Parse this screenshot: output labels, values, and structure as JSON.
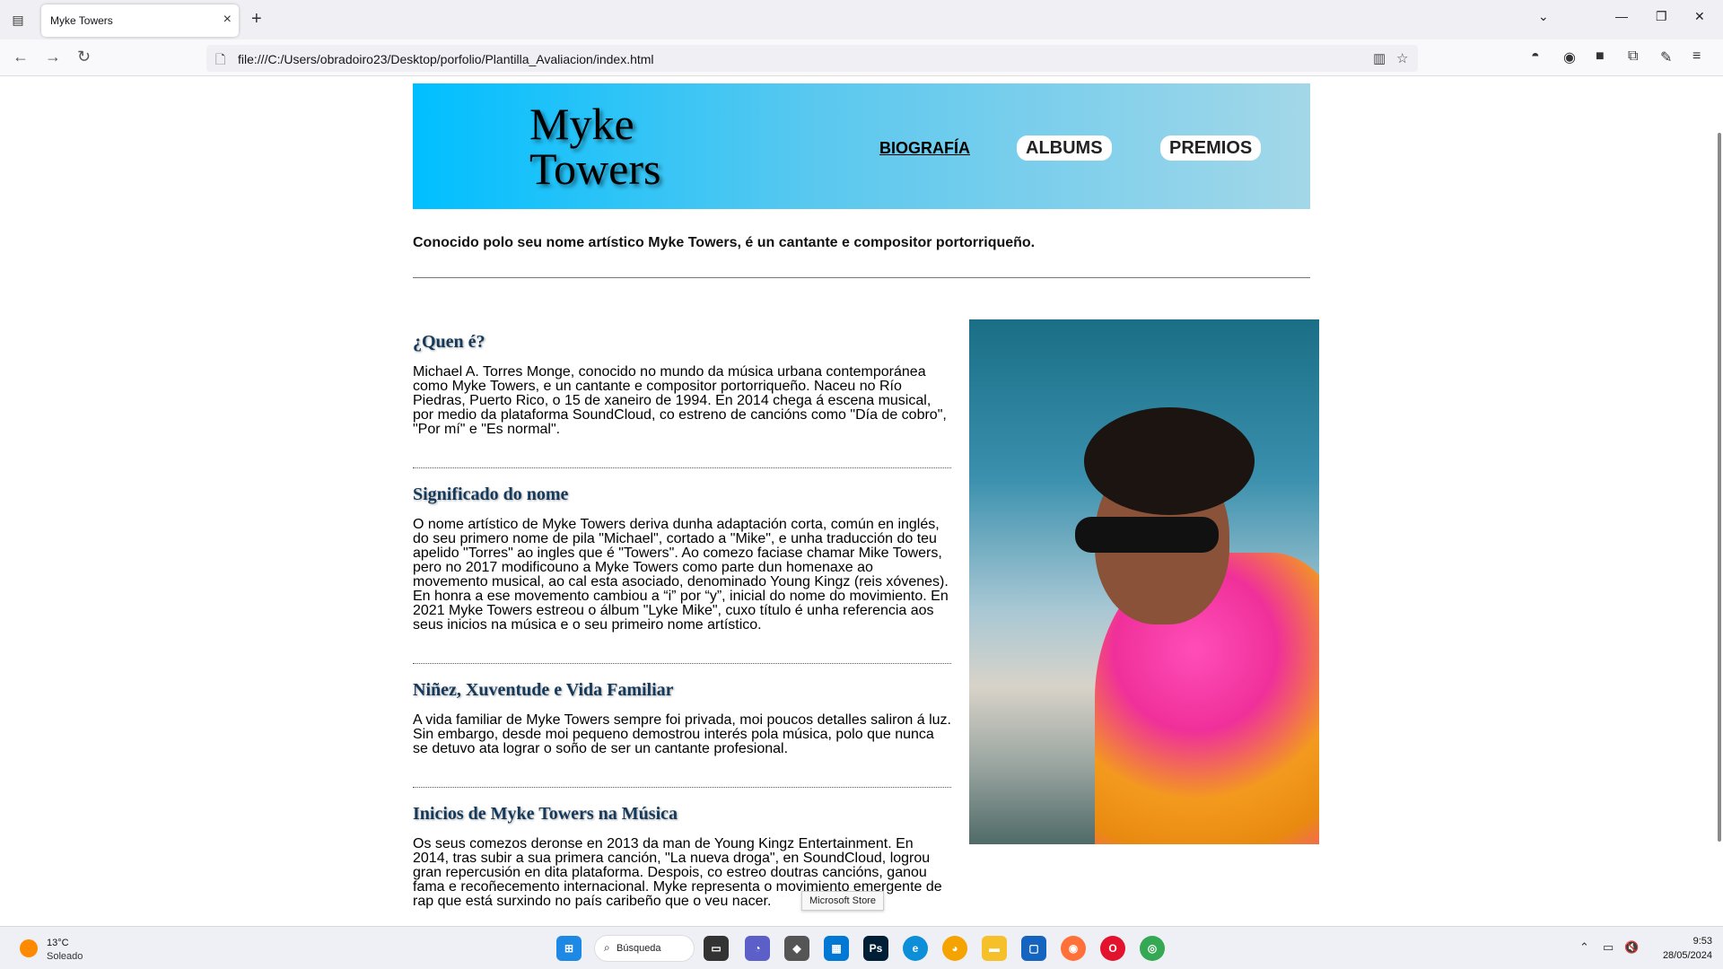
{
  "browser": {
    "tab_title": "Myke Towers",
    "url": "file:///C:/Users/obradoiro23/Desktop/porfolio/Plantilla_Avaliacion/index.html"
  },
  "site": {
    "logo_line1": "Myke",
    "logo_line2": "Towers",
    "menu": [
      "BIOGRAFÍA",
      "ALBUMS",
      "PREMIOS"
    ],
    "intro": "Conocido polo seu nome artístico Myke Towers, é un cantante e compositor portorriqueño.",
    "sections": [
      {
        "title": "¿Quen é?",
        "body": "Michael A. Torres Monge, conocido no mundo da música urbana contemporánea como Myke Towers, e un cantante e compositor portorriqueño. Naceu no Río Piedras, Puerto Rico, o 15 de xaneiro de 1994. En 2014 chega á escena musical, por medio da plataforma SoundCloud, co estreno de cancións como \"Día de cobro\", \"Por mí\" e \"Es normal\"."
      },
      {
        "title": "Significado do nome",
        "body": "O nome artístico de Myke Towers deriva dunha adaptación corta, común en inglés, do seu primero nome de pila \"Michael\", cortado a \"Mike\", e unha traducción do teu apelido \"Torres\" ao ingles que é \"Towers\". Ao comezo faciase chamar Mike Towers, pero no 2017 modificouno a Myke Towers como parte dun homenaxe ao movemento musical, ao cal esta asociado, denominado Young Kingz (reis xóvenes). En honra a ese movemento cambiou a “i” por “y”, inicial do nome do movimiento. En 2021 Myke Towers estreou o álbum \"Lyke Mike\", cuxo título é unha referencia aos seus inicios na música e o seu primeiro nome artístico."
      },
      {
        "title": "Niñez, Xuventude e Vida Familiar",
        "body": "A vida familiar de Myke Towers sempre foi privada, moi poucos detalles saliron á luz. Sin embargo, desde moi pequeno demostrou interés pola música, polo que nunca se detuvo ata lograr o soño de ser un cantante profesional."
      },
      {
        "title": "Inicios de Myke Towers na Música",
        "body": "Os seus comezos deronse en 2013 da man de Young Kingz Entertainment. En 2014, tras subir a sua primera canción, \"La nueva droga\", en SoundCloud, logrou gran repercusión en dita plataforma. Despois, co estreo doutras cancións, ganou fama e recoñecemento internacional. Myke representa o movimiento emergente de rap que está surxindo no país caribeño que o veu nacer."
      }
    ]
  },
  "tooltip": "Microsoft Store",
  "taskbar": {
    "temperature": "13°C",
    "weather": "Soleado",
    "search_label": "Búsqueda",
    "time": "9:53",
    "date": "28/05/2024"
  },
  "colors": {
    "header_gradient_start": "#00bfff",
    "header_gradient_end": "#a3d7e8",
    "section_title": "#15395a"
  }
}
